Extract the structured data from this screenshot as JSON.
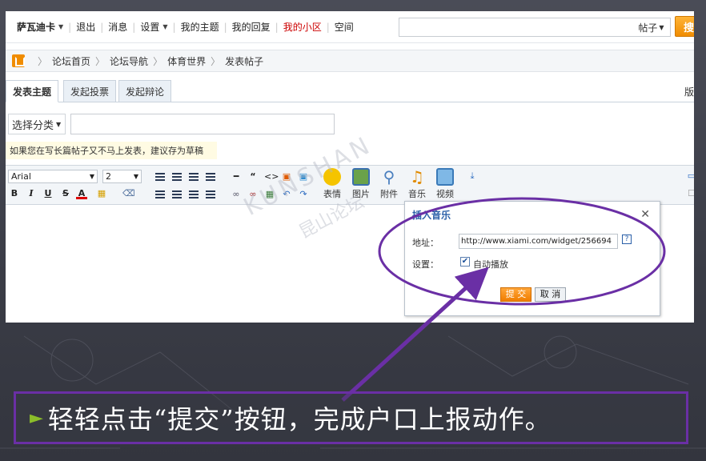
{
  "topbar": {
    "username": "萨瓦迪卡",
    "links": [
      "退出",
      "消息",
      "设置",
      "我的主题",
      "我的回复",
      "我的小区",
      "空间"
    ],
    "search_scope": "帖子",
    "search_button": "搜"
  },
  "breadcrumb": [
    "论坛首页",
    "论坛导航",
    "体育世界",
    "发表帖子"
  ],
  "tabs": [
    "发表主题",
    "发起投票",
    "发起辩论"
  ],
  "tab_right_label": "版",
  "category_select": "选择分类",
  "draft_tip": "如果您在写长篇帖子又不马上发表，建议存为草稿",
  "editor": {
    "font_name": "Arial",
    "font_size": "2",
    "tools": [
      "表情",
      "图片",
      "附件",
      "音乐",
      "视频"
    ]
  },
  "watermark": {
    "latin": "KUNSHAN",
    "cn": "昆山论坛"
  },
  "dialog": {
    "title": "插入音乐",
    "address_label": "地址：",
    "address_value": "http://www.xiami.com/widget/256694",
    "settings_label": "设置：",
    "autoplay_label": "自动播放",
    "autoplay_checked": true,
    "submit_label": "提 交",
    "cancel_label": "取 消"
  },
  "caption": "轻轻点击“提交”按钮，完成户口上报动作。",
  "colors": {
    "highlight_ellipse": "#6a2fa5",
    "caption_border": "#6a2fa5",
    "bullet": "#8bbd2a",
    "submit": "#f07d00"
  }
}
